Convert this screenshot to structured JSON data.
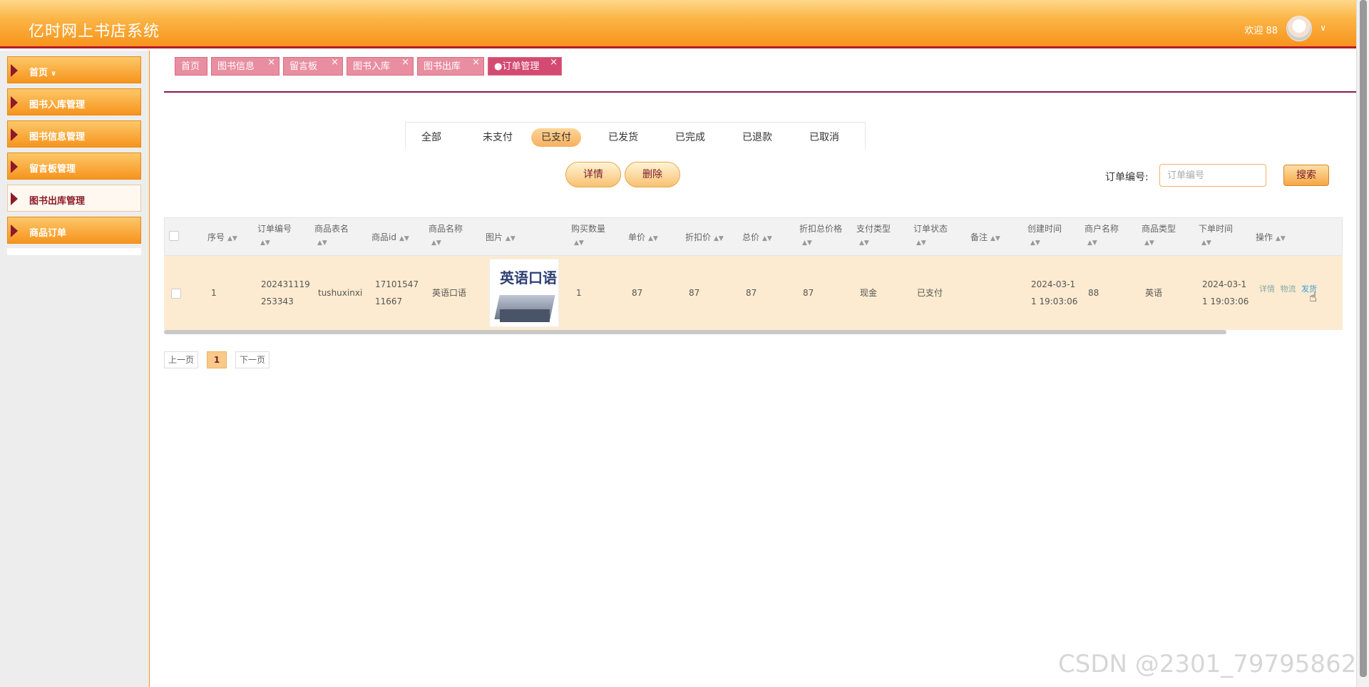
{
  "app": {
    "title": "亿时网上书店系统",
    "welcome": "欢迎 88"
  },
  "sidebar": {
    "items": [
      {
        "label": "首页",
        "sub": "∨"
      },
      {
        "label": "图书入库管理"
      },
      {
        "label": "图书信息管理"
      },
      {
        "label": "留言板管理"
      },
      {
        "label": "图书出库管理"
      },
      {
        "label": "商品订单"
      }
    ]
  },
  "tabs": [
    "首页",
    "图书信息",
    "留言板",
    "图书入库",
    "图书出库",
    "●订单管理"
  ],
  "filters": [
    "全部",
    "未支付",
    "已支付",
    "已发货",
    "已完成",
    "已退款",
    "已取消"
  ],
  "actions": {
    "detail": "详情",
    "delete": "删除"
  },
  "search": {
    "label": "订单编号:",
    "placeholder": "订单编号",
    "button": "搜索"
  },
  "table": {
    "headers": [
      "序号",
      "订单编号",
      "商品表名",
      "商品id",
      "商品名称",
      "图片",
      "购买数量",
      "单价",
      "折扣价",
      "总价",
      "折扣总价格",
      "支付类型",
      "订单状态",
      "备注",
      "创建时间",
      "商户名称",
      "商品类型",
      "下单时间",
      "操作"
    ],
    "row": {
      "seq": "1",
      "order_no_1": "202431119",
      "order_no_2": "253343",
      "table_name": "tushuxinxi",
      "goods_id_1": "17101547",
      "goods_id_2": "11667",
      "goods_name": "英语口语",
      "image_text": "英语口语",
      "qty": "1",
      "price": "87",
      "discount_price": "87",
      "total": "87",
      "discount_total": "87",
      "pay_type": "现金",
      "status": "已支付",
      "remark": "",
      "created_1": "2024-03-1",
      "created_2": "1 19:03:06",
      "merchant": "88",
      "goods_type": "英语",
      "ordered_1": "2024-03-1",
      "ordered_2": "1 19:03:06",
      "ops": [
        "详情",
        "物流",
        "发货"
      ]
    }
  },
  "pager": {
    "prev": "上一页",
    "current": "1",
    "next": "下一页"
  },
  "watermark": "CSDN @2301_79795862"
}
